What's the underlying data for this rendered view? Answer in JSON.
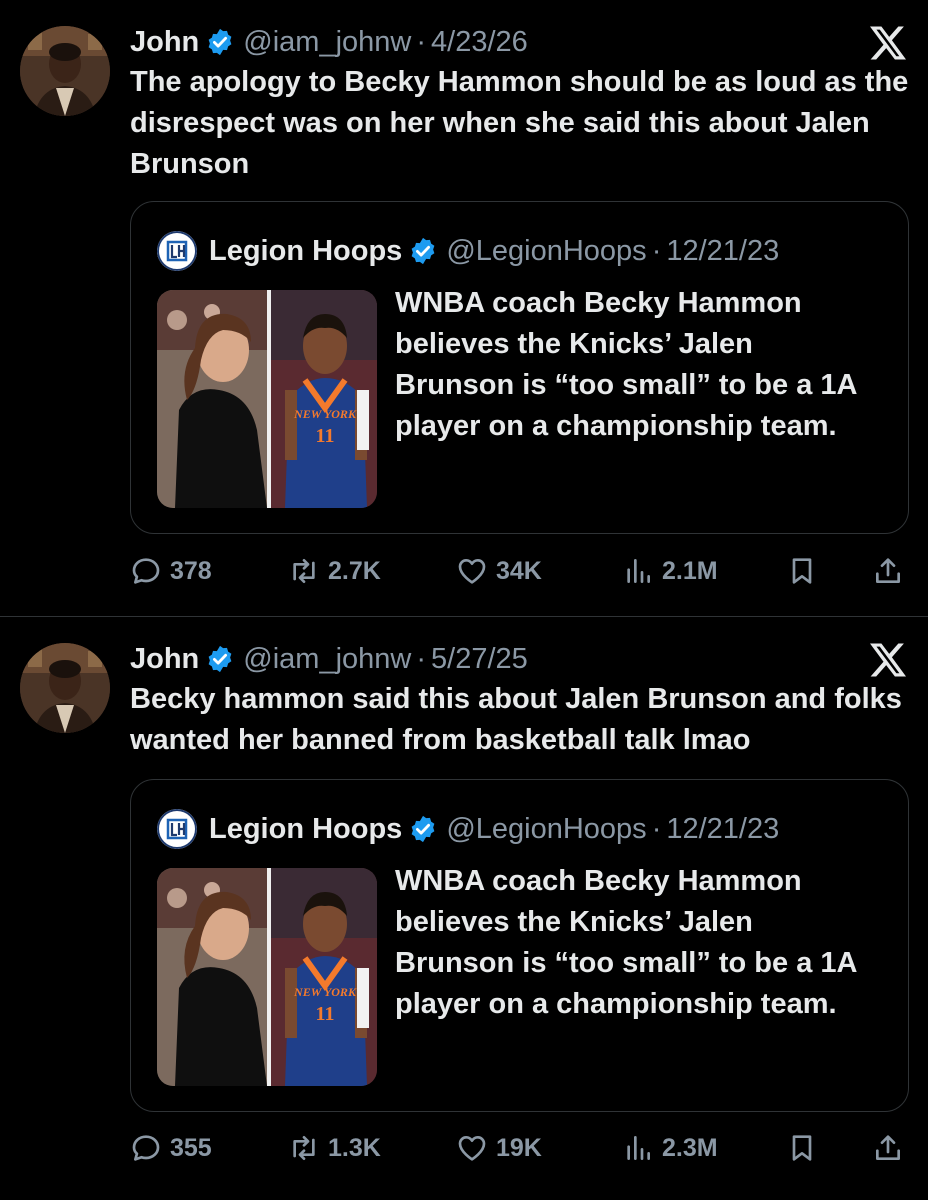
{
  "tweets": [
    {
      "author": {
        "name": "John",
        "handle": "@iam_johnw",
        "separator": "·",
        "date": "4/23/26"
      },
      "text": "The apology to Becky Hammon should be as loud as the disrespect was on her when she said this about Jalen Brunson",
      "quote": {
        "author": {
          "name": "Legion Hoops",
          "handle": "@LegionHoops",
          "separator": "·",
          "date": "12/21/23"
        },
        "text": "WNBA coach Becky Hammon believes the Knicks’ Jalen Brunson is “too small” to be a 1A player on a championship team.",
        "jersey_text": "NEW YORK",
        "jersey_number": "11"
      },
      "stats": {
        "replies": "378",
        "retweets": "2.7K",
        "likes": "34K",
        "views": "2.1M"
      }
    },
    {
      "author": {
        "name": "John",
        "handle": "@iam_johnw",
        "separator": "·",
        "date": "5/27/25"
      },
      "text": "Becky hammon said this about Jalen Brunson and folks wanted her banned from basketball talk lmao",
      "quote": {
        "author": {
          "name": "Legion Hoops",
          "handle": "@LegionHoops",
          "separator": "·",
          "date": "12/21/23"
        },
        "text": "WNBA coach Becky Hammon believes the Knicks’ Jalen Brunson is “too small” to be a 1A player on a championship team.",
        "jersey_text": "NEW YORK",
        "jersey_number": "11"
      },
      "stats": {
        "replies": "355",
        "retweets": "1.3K",
        "likes": "19K",
        "views": "2.3M"
      }
    }
  ],
  "colors": {
    "background": "#000000",
    "text": "#e7e9ea",
    "secondary": "#8b98a5",
    "verified": "#1d9bf0",
    "border": "#2f3336"
  },
  "icons": [
    "verified-badge-icon",
    "x-logo-icon",
    "reply-icon",
    "retweet-icon",
    "like-icon",
    "views-icon",
    "bookmark-icon",
    "share-icon",
    "legion-hoops-logo"
  ]
}
